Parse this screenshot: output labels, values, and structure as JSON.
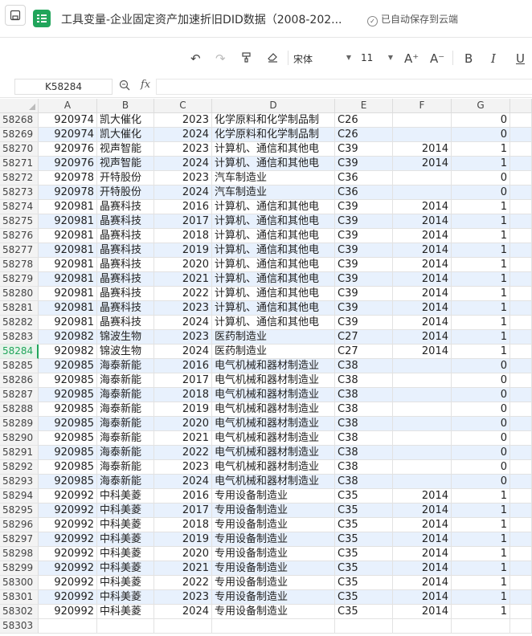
{
  "titlebar": {
    "doc_title": "工具变量-企业固定资产加速折旧DID数据（2008-202...",
    "saved_status": "已自动保存到云端"
  },
  "toolbar": {
    "font_name": "宋体",
    "font_size": "11",
    "bold": "B",
    "italic": "I",
    "underline": "U",
    "increase_font": "A⁺",
    "decrease_font": "A⁻"
  },
  "formula_bar": {
    "cell_ref": "K58284",
    "fx_label": "fx",
    "value": ""
  },
  "columns": [
    "A",
    "B",
    "C",
    "D",
    "E",
    "F",
    "G"
  ],
  "active_row": "58284",
  "rows": [
    {
      "n": "58268",
      "a": "920974",
      "b": "凯大催化",
      "c": "2023",
      "d": "化学原料和化学制品制",
      "e": "C26",
      "f": "",
      "g": "0",
      "alt": false
    },
    {
      "n": "58269",
      "a": "920974",
      "b": "凯大催化",
      "c": "2024",
      "d": "化学原料和化学制品制",
      "e": "C26",
      "f": "",
      "g": "0",
      "alt": true
    },
    {
      "n": "58270",
      "a": "920976",
      "b": "视声智能",
      "c": "2023",
      "d": "计算机、通信和其他电",
      "e": "C39",
      "f": "2014",
      "g": "1",
      "alt": false
    },
    {
      "n": "58271",
      "a": "920976",
      "b": "视声智能",
      "c": "2024",
      "d": "计算机、通信和其他电",
      "e": "C39",
      "f": "2014",
      "g": "1",
      "alt": true
    },
    {
      "n": "58272",
      "a": "920978",
      "b": "开特股份",
      "c": "2023",
      "d": "汽车制造业",
      "e": "C36",
      "f": "",
      "g": "0",
      "alt": false
    },
    {
      "n": "58273",
      "a": "920978",
      "b": "开特股份",
      "c": "2024",
      "d": "汽车制造业",
      "e": "C36",
      "f": "",
      "g": "0",
      "alt": true
    },
    {
      "n": "58274",
      "a": "920981",
      "b": "晶赛科技",
      "c": "2016",
      "d": "计算机、通信和其他电",
      "e": "C39",
      "f": "2014",
      "g": "1",
      "alt": false
    },
    {
      "n": "58275",
      "a": "920981",
      "b": "晶赛科技",
      "c": "2017",
      "d": "计算机、通信和其他电",
      "e": "C39",
      "f": "2014",
      "g": "1",
      "alt": true
    },
    {
      "n": "58276",
      "a": "920981",
      "b": "晶赛科技",
      "c": "2018",
      "d": "计算机、通信和其他电",
      "e": "C39",
      "f": "2014",
      "g": "1",
      "alt": false
    },
    {
      "n": "58277",
      "a": "920981",
      "b": "晶赛科技",
      "c": "2019",
      "d": "计算机、通信和其他电",
      "e": "C39",
      "f": "2014",
      "g": "1",
      "alt": true
    },
    {
      "n": "58278",
      "a": "920981",
      "b": "晶赛科技",
      "c": "2020",
      "d": "计算机、通信和其他电",
      "e": "C39",
      "f": "2014",
      "g": "1",
      "alt": false
    },
    {
      "n": "58279",
      "a": "920981",
      "b": "晶赛科技",
      "c": "2021",
      "d": "计算机、通信和其他电",
      "e": "C39",
      "f": "2014",
      "g": "1",
      "alt": true
    },
    {
      "n": "58280",
      "a": "920981",
      "b": "晶赛科技",
      "c": "2022",
      "d": "计算机、通信和其他电",
      "e": "C39",
      "f": "2014",
      "g": "1",
      "alt": false
    },
    {
      "n": "58281",
      "a": "920981",
      "b": "晶赛科技",
      "c": "2023",
      "d": "计算机、通信和其他电",
      "e": "C39",
      "f": "2014",
      "g": "1",
      "alt": true
    },
    {
      "n": "58282",
      "a": "920981",
      "b": "晶赛科技",
      "c": "2024",
      "d": "计算机、通信和其他电",
      "e": "C39",
      "f": "2014",
      "g": "1",
      "alt": false
    },
    {
      "n": "58283",
      "a": "920982",
      "b": "锦波生物",
      "c": "2023",
      "d": "医药制造业",
      "e": "C27",
      "f": "2014",
      "g": "1",
      "alt": true
    },
    {
      "n": "58284",
      "a": "920982",
      "b": "锦波生物",
      "c": "2024",
      "d": "医药制造业",
      "e": "C27",
      "f": "2014",
      "g": "1",
      "alt": false
    },
    {
      "n": "58285",
      "a": "920985",
      "b": "海泰新能",
      "c": "2016",
      "d": "电气机械和器材制造业",
      "e": "C38",
      "f": "",
      "g": "0",
      "alt": true
    },
    {
      "n": "58286",
      "a": "920985",
      "b": "海泰新能",
      "c": "2017",
      "d": "电气机械和器材制造业",
      "e": "C38",
      "f": "",
      "g": "0",
      "alt": false
    },
    {
      "n": "58287",
      "a": "920985",
      "b": "海泰新能",
      "c": "2018",
      "d": "电气机械和器材制造业",
      "e": "C38",
      "f": "",
      "g": "0",
      "alt": true
    },
    {
      "n": "58288",
      "a": "920985",
      "b": "海泰新能",
      "c": "2019",
      "d": "电气机械和器材制造业",
      "e": "C38",
      "f": "",
      "g": "0",
      "alt": false
    },
    {
      "n": "58289",
      "a": "920985",
      "b": "海泰新能",
      "c": "2020",
      "d": "电气机械和器材制造业",
      "e": "C38",
      "f": "",
      "g": "0",
      "alt": true
    },
    {
      "n": "58290",
      "a": "920985",
      "b": "海泰新能",
      "c": "2021",
      "d": "电气机械和器材制造业",
      "e": "C38",
      "f": "",
      "g": "0",
      "alt": false
    },
    {
      "n": "58291",
      "a": "920985",
      "b": "海泰新能",
      "c": "2022",
      "d": "电气机械和器材制造业",
      "e": "C38",
      "f": "",
      "g": "0",
      "alt": true
    },
    {
      "n": "58292",
      "a": "920985",
      "b": "海泰新能",
      "c": "2023",
      "d": "电气机械和器材制造业",
      "e": "C38",
      "f": "",
      "g": "0",
      "alt": false
    },
    {
      "n": "58293",
      "a": "920985",
      "b": "海泰新能",
      "c": "2024",
      "d": "电气机械和器材制造业",
      "e": "C38",
      "f": "",
      "g": "0",
      "alt": true
    },
    {
      "n": "58294",
      "a": "920992",
      "b": "中科美菱",
      "c": "2016",
      "d": "专用设备制造业",
      "e": "C35",
      "f": "2014",
      "g": "1",
      "alt": false
    },
    {
      "n": "58295",
      "a": "920992",
      "b": "中科美菱",
      "c": "2017",
      "d": "专用设备制造业",
      "e": "C35",
      "f": "2014",
      "g": "1",
      "alt": true
    },
    {
      "n": "58296",
      "a": "920992",
      "b": "中科美菱",
      "c": "2018",
      "d": "专用设备制造业",
      "e": "C35",
      "f": "2014",
      "g": "1",
      "alt": false
    },
    {
      "n": "58297",
      "a": "920992",
      "b": "中科美菱",
      "c": "2019",
      "d": "专用设备制造业",
      "e": "C35",
      "f": "2014",
      "g": "1",
      "alt": true
    },
    {
      "n": "58298",
      "a": "920992",
      "b": "中科美菱",
      "c": "2020",
      "d": "专用设备制造业",
      "e": "C35",
      "f": "2014",
      "g": "1",
      "alt": false
    },
    {
      "n": "58299",
      "a": "920992",
      "b": "中科美菱",
      "c": "2021",
      "d": "专用设备制造业",
      "e": "C35",
      "f": "2014",
      "g": "1",
      "alt": true
    },
    {
      "n": "58300",
      "a": "920992",
      "b": "中科美菱",
      "c": "2022",
      "d": "专用设备制造业",
      "e": "C35",
      "f": "2014",
      "g": "1",
      "alt": false
    },
    {
      "n": "58301",
      "a": "920992",
      "b": "中科美菱",
      "c": "2023",
      "d": "专用设备制造业",
      "e": "C35",
      "f": "2014",
      "g": "1",
      "alt": true
    },
    {
      "n": "58302",
      "a": "920992",
      "b": "中科美菱",
      "c": "2024",
      "d": "专用设备制造业",
      "e": "C35",
      "f": "2014",
      "g": "1",
      "alt": false
    },
    {
      "n": "58303",
      "a": "",
      "b": "",
      "c": "",
      "d": "",
      "e": "",
      "f": "",
      "g": "",
      "alt": false
    }
  ]
}
